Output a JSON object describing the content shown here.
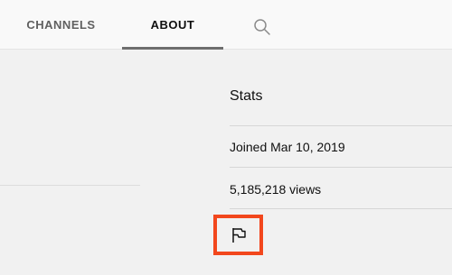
{
  "tabs": [
    {
      "label": "CHANNELS"
    },
    {
      "label": "ABOUT"
    }
  ],
  "icons": {
    "search": "search-icon",
    "flag": "flag-icon"
  },
  "stats": {
    "title": "Stats",
    "joined": "Joined Mar 10, 2019",
    "views": "5,185,218 views"
  },
  "colors": {
    "highlight": "#f2471d",
    "tab_indicator": "#6e6e6e"
  }
}
